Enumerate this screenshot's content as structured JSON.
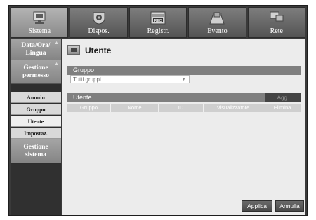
{
  "tabs": [
    {
      "label": "Sistema",
      "icon": "monitor-icon",
      "active": true
    },
    {
      "label": "Dispos.",
      "icon": "camera-icon",
      "active": false
    },
    {
      "label": "Registr.",
      "icon": "rec-icon",
      "active": false
    },
    {
      "label": "Evento",
      "icon": "event-icon",
      "active": false
    },
    {
      "label": "Rete",
      "icon": "network-icon",
      "active": false
    }
  ],
  "sidebar": {
    "data_ora": "Data/Ora/\nLingua",
    "gestione_permesso": "Gestione\npermesso",
    "subitems": [
      "Ammin",
      "Gruppo",
      "Utente",
      "Impostaz."
    ],
    "gestione_sistema": "Gestione\nsistema"
  },
  "main": {
    "title": "Utente",
    "group_label": "Gruppo",
    "group_value": "Tutti gruppi",
    "user_label": "Utente",
    "add_label": "Agg.",
    "columns": [
      "Gruppo",
      "Nome",
      "ID",
      "Visualizzatore",
      "Elimina"
    ],
    "apply_label": "Applica",
    "cancel_label": "Annulla"
  }
}
